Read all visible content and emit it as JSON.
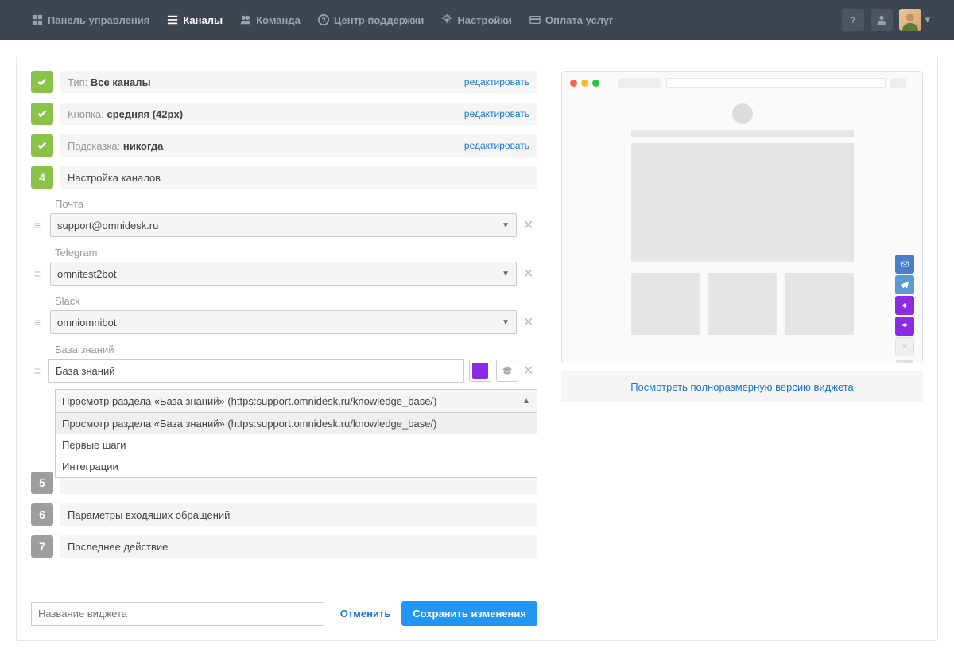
{
  "nav": {
    "items": [
      {
        "label": "Панель управления",
        "icon": "dashboard"
      },
      {
        "label": "Каналы",
        "icon": "list",
        "active": true
      },
      {
        "label": "Команда",
        "icon": "users"
      },
      {
        "label": "Центр поддержки",
        "icon": "help"
      },
      {
        "label": "Настройки",
        "icon": "gear"
      },
      {
        "label": "Оплата услуг",
        "icon": "card"
      }
    ]
  },
  "steps": {
    "done": [
      {
        "prefix": "Тип:",
        "value": "Все каналы",
        "edit": "редактировать"
      },
      {
        "prefix": "Кнопка:",
        "value": "средняя (42px)",
        "edit": "редактировать"
      },
      {
        "prefix": "Подсказка:",
        "value": "никогда",
        "edit": "редактировать"
      }
    ],
    "active": {
      "num": "4",
      "title": "Настройка каналов"
    },
    "pending": [
      {
        "num": "5",
        "title": ""
      },
      {
        "num": "6",
        "title": "Параметры входящих обращений"
      },
      {
        "num": "7",
        "title": "Последнее действие"
      }
    ]
  },
  "channels": {
    "mail": {
      "label": "Почта",
      "value": "support@omnidesk.ru"
    },
    "telegram": {
      "label": "Telegram",
      "value": "omnitest2bot"
    },
    "slack": {
      "label": "Slack",
      "value": "omniomnibot"
    },
    "kb": {
      "label": "База знаний",
      "input_value": "База знаний",
      "select_value": "Просмотр раздела «База знаний» (https:support.omnidesk.ru/knowledge_base/)",
      "options": [
        "Просмотр раздела «База знаний» (https:support.omnidesk.ru/knowledge_base/)",
        "Первые шаги",
        "Интеграции"
      ]
    }
  },
  "preview": {
    "link": "Посмотреть полноразмерную версию виджета"
  },
  "footer": {
    "placeholder": "Название виджета",
    "cancel": "Отменить",
    "save": "Сохранить изменения"
  }
}
